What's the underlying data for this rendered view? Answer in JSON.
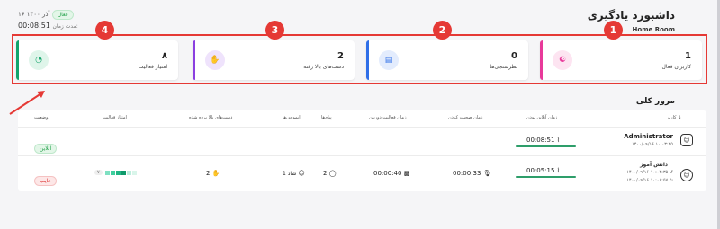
{
  "header": {
    "title": "داشبورد یادگیری",
    "subtitle": "Home Room",
    "date": "۱۶ آذر ۱۴۰۰",
    "status_badge": "فعال",
    "duration_label": "مدت زمان:",
    "duration_value": "00:08:51"
  },
  "cards": [
    {
      "value": "1",
      "label": "کاربران فعال",
      "icon": "users-icon",
      "color": "#e8399a",
      "badge": "1"
    },
    {
      "value": "0",
      "label": "نظرسنجی‌ها",
      "icon": "clipboard-icon",
      "color": "#2f6fe8",
      "badge": "2"
    },
    {
      "value": "2",
      "label": "دست‌های بالا رفته",
      "icon": "hand-icon",
      "color": "#8b3fe0",
      "badge": "3"
    },
    {
      "value": "۸",
      "label": "امتیاز فعالیت",
      "icon": "pie-chart-icon",
      "color": "#13a36b",
      "badge": "4"
    }
  ],
  "overview": {
    "title": "مرور کلی",
    "columns": [
      "کاربر",
      "زمان آنلاین بودن",
      "زمان صحبت کردن",
      "زمان فعالیت دوربین",
      "پیام‌ها",
      "ایموجی‌ها",
      "دست‌های بالا برده شده",
      "امتیاز فعالیت",
      "وضعیت"
    ],
    "rows": [
      {
        "name": "Administrator",
        "meta": "۱۴۰۰/۰۹/۱۶ ۱۰:۰۳:۳۵",
        "online": "00:08:51",
        "talk": "",
        "camera": "",
        "messages": "",
        "emojis": "",
        "hands": "",
        "status": "آنلاین"
      },
      {
        "name": "دانش آموز",
        "meta1": "۱۴۰۰/۰۹/۱۶ ۱۰:۰۳:۳۵",
        "meta2": "۱۴۰۰/۰۹/۱۶ ۱۰:۰۸:۵۷",
        "online": "00:05:15",
        "talk": "00:00:33",
        "camera": "00:00:40",
        "messages": "2",
        "emojis": "1 شاد",
        "hands": "2",
        "activity_count": "۷",
        "status": "غایب"
      }
    ]
  },
  "colors": {
    "accent_red": "#e53935",
    "green": "#2e9e6a"
  }
}
